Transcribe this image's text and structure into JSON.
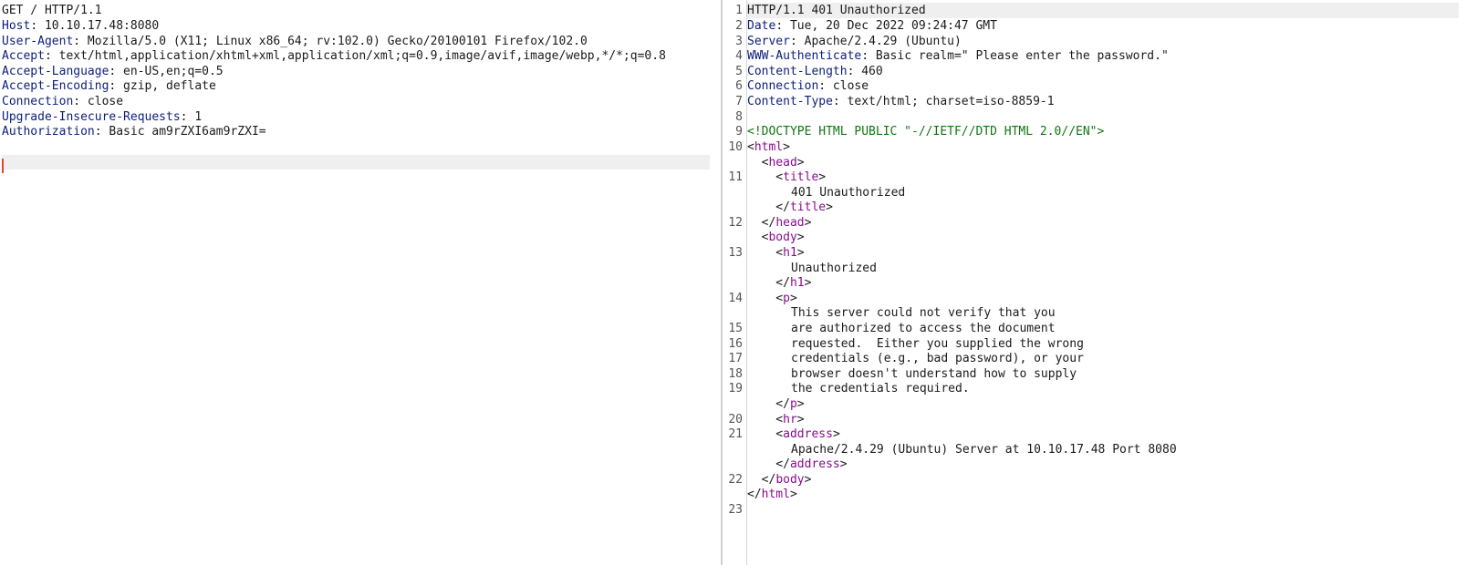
{
  "request": {
    "request_line": "GET / HTTP/1.1",
    "headers": [
      {
        "key": "Host",
        "value": " 10.10.17.48:8080"
      },
      {
        "key": "User-Agent",
        "value": " Mozilla/5.0 (X11; Linux x86_64; rv:102.0) Gecko/20100101 Firefox/102.0"
      },
      {
        "key": "Accept",
        "value": " text/html,application/xhtml+xml,application/xml;q=0.9,image/avif,image/webp,*/*;q=0.8"
      },
      {
        "key": "Accept-Language",
        "value": " en-US,en;q=0.5"
      },
      {
        "key": "Accept-Encoding",
        "value": " gzip, deflate"
      },
      {
        "key": "Connection",
        "value": " close"
      },
      {
        "key": "Upgrade-Insecure-Requests",
        "value": " 1"
      },
      {
        "key": "Authorization",
        "value": " Basic am9rZXI6am9rZXI="
      }
    ]
  },
  "response": {
    "line_numbers": [
      "1",
      "2",
      "3",
      "4",
      "5",
      "6",
      "7",
      "8",
      "9",
      "10",
      "11",
      "12",
      "13",
      "14",
      "15",
      "16",
      "17",
      "18",
      "19",
      "20",
      "21",
      "22",
      "23"
    ],
    "status_line": "HTTP/1.1 401 Unauthorized",
    "headers": [
      {
        "key": "Date",
        "value": " Tue, 20 Dec 2022 09:24:47 GMT"
      },
      {
        "key": "Server",
        "value": " Apache/2.4.29 (Ubuntu)"
      },
      {
        "key": "WWW-Authenticate",
        "value": " Basic realm=\" Please enter the password.\""
      },
      {
        "key": "Content-Length",
        "value": " 460"
      },
      {
        "key": "Connection",
        "value": " close"
      },
      {
        "key": "Content-Type",
        "value": " text/html; charset=iso-8859-1"
      }
    ],
    "doctype": "<!DOCTYPE HTML PUBLIC \"-//IETF//DTD HTML 2.0//EN\">",
    "body": {
      "title": "401 Unauthorized",
      "h1": "Unauthorized",
      "p_lines": [
        "This server could not verify that you",
        "are authorized to access the document",
        "requested.  Either you supplied the wrong",
        "credentials (e.g., bad password), or your",
        "browser doesn't understand how to supply",
        "the credentials required."
      ],
      "address": "Apache/2.4.29 (Ubuntu) Server at 10.10.17.48 Port 8080"
    }
  }
}
